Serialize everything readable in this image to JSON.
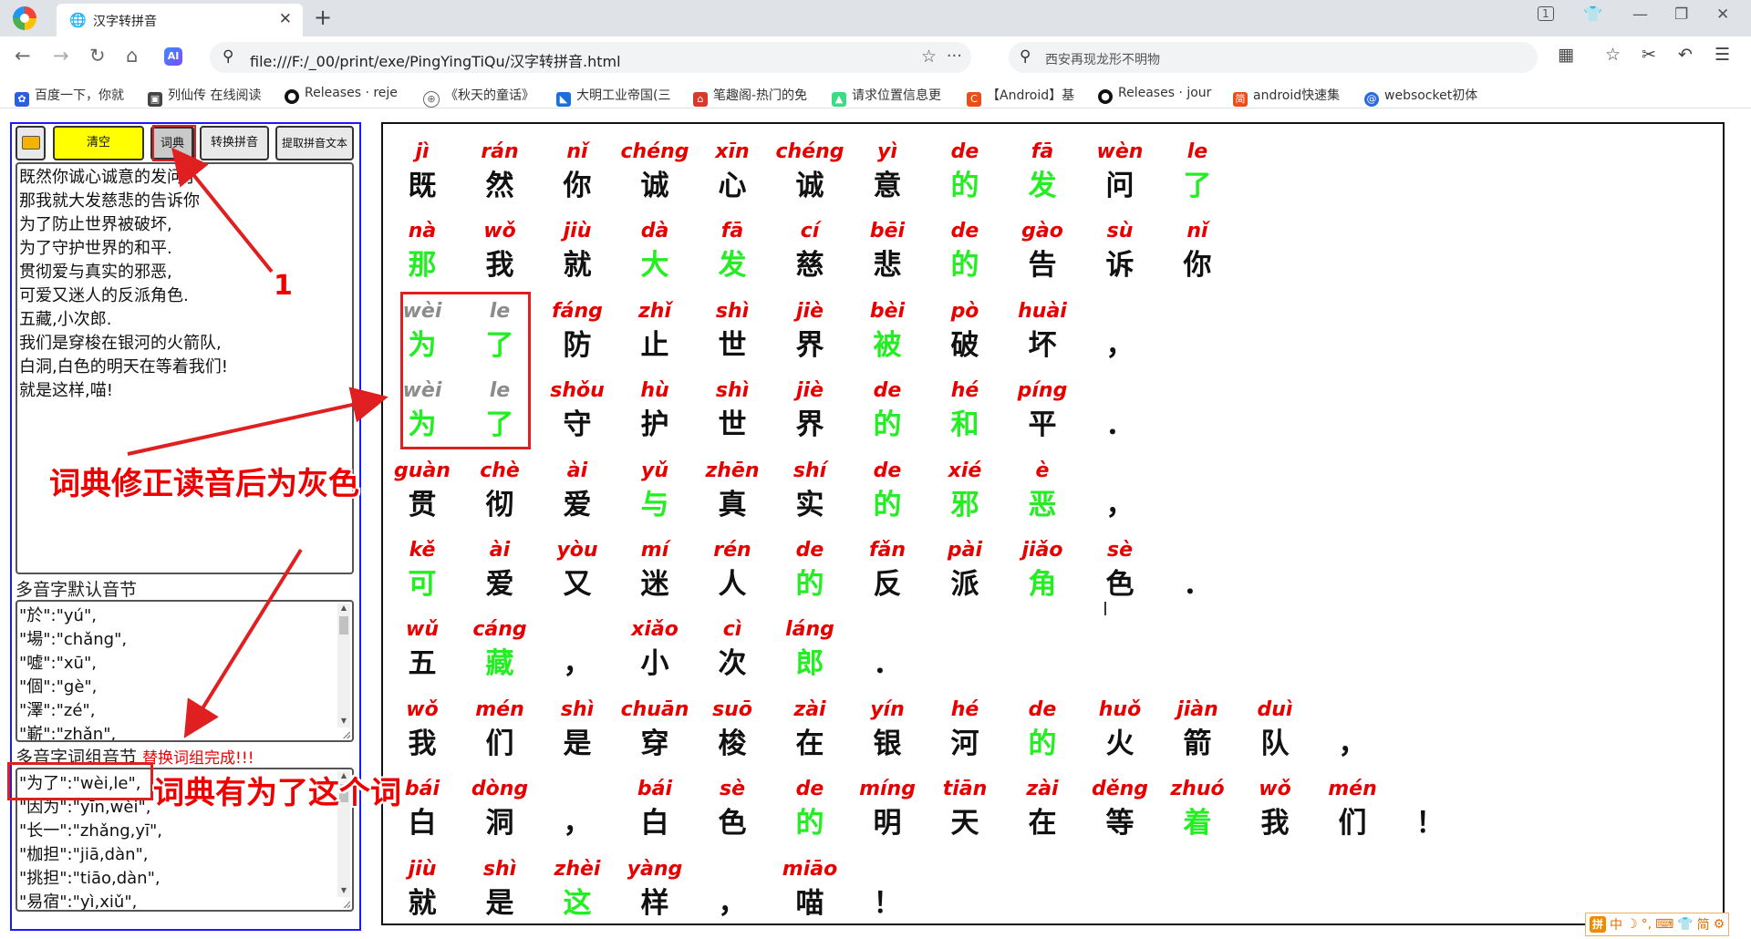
{
  "browser": {
    "tab_title": "汉字转拼音",
    "tab_count": "1",
    "url": "file:///F:/_00/print/exe/PingYingTiQu/汉字转拼音.html",
    "search_text": "西安再现龙形不明物",
    "ai_label": "AI",
    "bookmarks": [
      {
        "label": "百度一下，你就",
        "icon": "paw-icon",
        "color": "#2b5fe0"
      },
      {
        "label": "列仙传 在线阅读",
        "icon": "book-icon",
        "color": "#444444"
      },
      {
        "label": "Releases · reje",
        "icon": "github-icon",
        "color": "#111111"
      },
      {
        "label": "《秋天的童话》",
        "icon": "globe-icon",
        "color": "#666666"
      },
      {
        "label": "大明工业帝国(三",
        "icon": "shark-icon",
        "color": "#1e6fd9"
      },
      {
        "label": "笔趣阁-热门的免",
        "icon": "house-icon",
        "color": "#d63a2b"
      },
      {
        "label": "请求位置信息更",
        "icon": "android-icon",
        "color": "#3ddc84"
      },
      {
        "label": "【Android】基",
        "icon": "c-icon",
        "color": "#e8501a"
      },
      {
        "label": "Releases · jour",
        "icon": "github-icon",
        "color": "#111111"
      },
      {
        "label": "android快速集",
        "icon": "jian-icon",
        "color": "#e8501a"
      },
      {
        "label": "websocket初体",
        "icon": "swirl-icon",
        "color": "#2a6be0"
      }
    ]
  },
  "toolbar": {
    "clear_label": "清空",
    "dict_label": "词典",
    "convert_label": "转换拼音",
    "extract_label": "提取拼音文本"
  },
  "input_lines": [
    "既然你诚心诚意的发问了",
    "那我就大发慈悲的告诉你",
    "为了防止世界被破坏,",
    "为了守护世界的和平.",
    "贯彻爱与真实的邪恶,",
    "可爱又迷人的反派角色.",
    "五藏,小次郎.",
    "我们是穿梭在银河的火箭队,",
    "白洞,白色的明天在等着我们!",
    "就是这样,喵!"
  ],
  "default_section": {
    "label": "多音字默认音节",
    "lines": [
      "\"於\":\"yú\",",
      "\"場\":\"chǎng\",",
      "\"噓\":\"xū\",",
      "\"個\":\"gè\",",
      "\"澤\":\"zé\",",
      "\"嶄\":\"zhǎn\","
    ]
  },
  "phrase_section": {
    "label": "多音字词组音节",
    "status": "替换词组完成!!!",
    "lines": [
      "\"为了\":\"wèi,le\",",
      "\"因为\":\"yīn,wèi\",",
      "\"长一\":\"zhǎng,yī\",",
      "\"枷担\":\"jiā,dàn\",",
      "\"挑担\":\"tiāo,dàn\",",
      "\"易宿\":\"yì,xiǔ\","
    ]
  },
  "annotations": {
    "number_label": "1",
    "gray_note": "词典修正读音后为灰色",
    "dict_note": "词典有为了这个词"
  },
  "ime": {
    "logo": "拼",
    "items": [
      "中",
      "☽",
      "°,",
      "⌨",
      "👕",
      "简",
      "⚙"
    ]
  },
  "colors": {
    "pinyin": "#e60000",
    "pinyin_dict": "#8c8c8c",
    "char_default": "#111111",
    "char_polyphonic": "#22ee22",
    "annotation": "#e02020",
    "panel_border": "#1a1aff"
  },
  "pinyin_rows": [
    [
      [
        "jì",
        "既",
        ""
      ],
      [
        "rán",
        "然",
        ""
      ],
      [
        "nǐ",
        "你",
        ""
      ],
      [
        "chéng",
        "诚",
        ""
      ],
      [
        "xīn",
        "心",
        ""
      ],
      [
        "chéng",
        "诚",
        ""
      ],
      [
        "yì",
        "意",
        ""
      ],
      [
        "de",
        "的",
        "g"
      ],
      [
        "fā",
        "发",
        "g"
      ],
      [
        "wèn",
        "问",
        ""
      ],
      [
        "le",
        "了",
        "g"
      ]
    ],
    [
      [
        "nà",
        "那",
        "g"
      ],
      [
        "wǒ",
        "我",
        ""
      ],
      [
        "jiù",
        "就",
        ""
      ],
      [
        "dà",
        "大",
        "g"
      ],
      [
        "fā",
        "发",
        "g"
      ],
      [
        "cí",
        "慈",
        ""
      ],
      [
        "bēi",
        "悲",
        ""
      ],
      [
        "de",
        "的",
        "g"
      ],
      [
        "gào",
        "告",
        ""
      ],
      [
        "sù",
        "诉",
        ""
      ],
      [
        "nǐ",
        "你",
        ""
      ]
    ],
    [
      [
        "wèi",
        "为",
        "gd"
      ],
      [
        "le",
        "了",
        "gd"
      ],
      [
        "fáng",
        "防",
        ""
      ],
      [
        "zhǐ",
        "止",
        ""
      ],
      [
        "shì",
        "世",
        ""
      ],
      [
        "jiè",
        "界",
        ""
      ],
      [
        "bèi",
        "被",
        "g"
      ],
      [
        "pò",
        "破",
        ""
      ],
      [
        "huài",
        "坏",
        ""
      ],
      [
        "",
        "，",
        ""
      ]
    ],
    [
      [
        "wèi",
        "为",
        "gd"
      ],
      [
        "le",
        "了",
        "gd"
      ],
      [
        "shǒu",
        "守",
        ""
      ],
      [
        "hù",
        "护",
        ""
      ],
      [
        "shì",
        "世",
        ""
      ],
      [
        "jiè",
        "界",
        ""
      ],
      [
        "de",
        "的",
        "g"
      ],
      [
        "hé",
        "和",
        "g"
      ],
      [
        "píng",
        "平",
        ""
      ],
      [
        "",
        "．",
        ""
      ]
    ],
    [
      [
        "guàn",
        "贯",
        ""
      ],
      [
        "chè",
        "彻",
        ""
      ],
      [
        "ài",
        "爱",
        ""
      ],
      [
        "yǔ",
        "与",
        "g"
      ],
      [
        "zhēn",
        "真",
        ""
      ],
      [
        "shí",
        "实",
        ""
      ],
      [
        "de",
        "的",
        "g"
      ],
      [
        "xié",
        "邪",
        "g"
      ],
      [
        "è",
        "恶",
        "g"
      ],
      [
        "",
        "，",
        ""
      ]
    ],
    [
      [
        "kě",
        "可",
        "g"
      ],
      [
        "ài",
        "爱",
        ""
      ],
      [
        "yòu",
        "又",
        ""
      ],
      [
        "mí",
        "迷",
        ""
      ],
      [
        "rén",
        "人",
        ""
      ],
      [
        "de",
        "的",
        "g"
      ],
      [
        "fǎn",
        "反",
        ""
      ],
      [
        "pài",
        "派",
        ""
      ],
      [
        "jiǎo",
        "角",
        "g"
      ],
      [
        "sè",
        "色",
        ""
      ],
      [
        "",
        "．",
        ""
      ]
    ],
    [
      [
        "wǔ",
        "五",
        ""
      ],
      [
        "cáng",
        "藏",
        "g"
      ],
      [
        "",
        "，",
        ""
      ],
      [
        "xiǎo",
        "小",
        ""
      ],
      [
        "cì",
        "次",
        ""
      ],
      [
        "láng",
        "郎",
        "g"
      ],
      [
        "",
        "．",
        ""
      ]
    ],
    [
      [
        "wǒ",
        "我",
        ""
      ],
      [
        "mén",
        "们",
        ""
      ],
      [
        "shì",
        "是",
        ""
      ],
      [
        "chuān",
        "穿",
        ""
      ],
      [
        "suō",
        "梭",
        ""
      ],
      [
        "zài",
        "在",
        ""
      ],
      [
        "yín",
        "银",
        ""
      ],
      [
        "hé",
        "河",
        ""
      ],
      [
        "de",
        "的",
        "g"
      ],
      [
        "huǒ",
        "火",
        ""
      ],
      [
        "jiàn",
        "箭",
        ""
      ],
      [
        "duì",
        "队",
        ""
      ],
      [
        "",
        "，",
        ""
      ]
    ],
    [
      [
        "bái",
        "白",
        ""
      ],
      [
        "dòng",
        "洞",
        ""
      ],
      [
        "",
        "，",
        ""
      ],
      [
        "bái",
        "白",
        ""
      ],
      [
        "sè",
        "色",
        ""
      ],
      [
        "de",
        "的",
        "g"
      ],
      [
        "míng",
        "明",
        ""
      ],
      [
        "tiān",
        "天",
        ""
      ],
      [
        "zài",
        "在",
        ""
      ],
      [
        "děng",
        "等",
        ""
      ],
      [
        "zhuó",
        "着",
        "g"
      ],
      [
        "wǒ",
        "我",
        ""
      ],
      [
        "mén",
        "们",
        ""
      ],
      [
        "",
        "！",
        ""
      ]
    ],
    [
      [
        "jiù",
        "就",
        ""
      ],
      [
        "shì",
        "是",
        ""
      ],
      [
        "zhèi",
        "这",
        "g"
      ],
      [
        "yàng",
        "样",
        ""
      ],
      [
        "",
        "，",
        ""
      ],
      [
        "miāo",
        "喵",
        ""
      ],
      [
        "",
        "！",
        ""
      ]
    ]
  ]
}
